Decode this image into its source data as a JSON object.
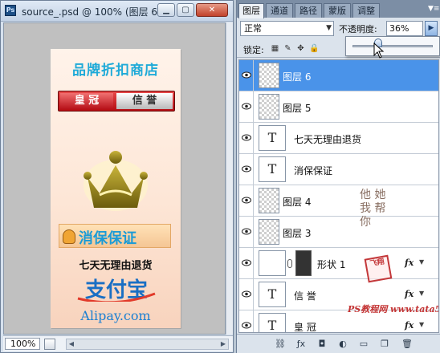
{
  "document": {
    "ps_badge": "Ps",
    "title": "source_.psd @ 100% (图层 6...",
    "min_label": "▁",
    "max_label": "▢",
    "close_label": "✕",
    "zoom": "100%",
    "artwork": {
      "shop_title": "品牌折扣商店",
      "banner_left": "皇 冠",
      "banner_right": "信 誉",
      "guarantee": "消保保证",
      "return_policy": "七天无理由退货",
      "alipay_cn": "支付宝",
      "alipay_en": "Alipay.com"
    }
  },
  "panel": {
    "tabs": [
      "图层",
      "通道",
      "路径",
      "蒙版",
      "调整"
    ],
    "active_tab": 0,
    "blend_mode": "正常",
    "opacity_label": "不透明度:",
    "opacity_value": "36%",
    "lock_label": "锁定:",
    "layers": [
      {
        "name": "图层 6",
        "kind": "raster",
        "selected": true
      },
      {
        "name": "图层 5",
        "kind": "raster",
        "selected": false
      },
      {
        "name": "七天无理由退货",
        "kind": "text",
        "selected": false
      },
      {
        "name": "消保保证",
        "kind": "text",
        "selected": false
      },
      {
        "name": "图层 4",
        "kind": "raster",
        "selected": false
      },
      {
        "name": "图层 3",
        "kind": "raster",
        "selected": false
      },
      {
        "name": "形状 1",
        "kind": "shape",
        "selected": false,
        "fx": "fx"
      },
      {
        "name": "信 誉",
        "kind": "text",
        "selected": false,
        "fx": "fx"
      },
      {
        "name": "皇 冠",
        "kind": "text",
        "selected": false,
        "fx": "fx"
      }
    ],
    "watermark": {
      "handwriting": "他 她 我 帮 你",
      "seal": "飞翔",
      "site": "PS教程网 www.tata580.com"
    }
  },
  "colors": {
    "selection": "#4a93e9",
    "accent_blue": "#1eaad8",
    "banner_red": "#c81a1e"
  }
}
